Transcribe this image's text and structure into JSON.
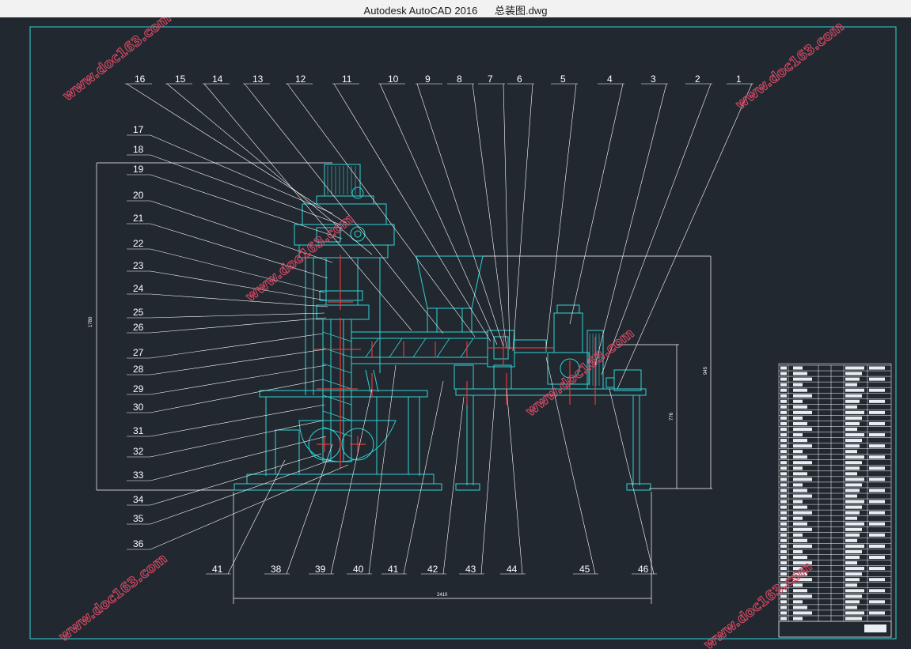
{
  "window": {
    "app_title": "Autodesk AutoCAD 2016",
    "file_name": "总装图.dwg"
  },
  "watermark": {
    "text": "www.doc163.com"
  },
  "colors": {
    "background": "#212830",
    "border": "#2fd3d3",
    "callout": "#ffffff",
    "section": "#e33a3a",
    "machine": "#2fd3d3",
    "watermark": "#d84a64"
  },
  "drawing": {
    "top_callouts": [
      "16",
      "15",
      "14",
      "13",
      "12",
      "11",
      "10",
      "9",
      "8",
      "7",
      "6",
      "5",
      "4",
      "3",
      "2",
      "1"
    ],
    "left_callouts": [
      "17",
      "18",
      "19",
      "20",
      "21",
      "22",
      "23",
      "24",
      "25",
      "26",
      "27",
      "28",
      "29",
      "30",
      "31",
      "32",
      "33",
      "34",
      "35",
      "36"
    ],
    "bottom_callouts": [
      "41",
      "38",
      "39",
      "40",
      "41",
      "42",
      "43",
      "44",
      "45",
      "46"
    ],
    "dimensions": {
      "overall_width": "2410",
      "overall_height": "1780",
      "right_height": "945",
      "base_height": "776"
    },
    "title_block": {
      "row_count": 46
    }
  }
}
